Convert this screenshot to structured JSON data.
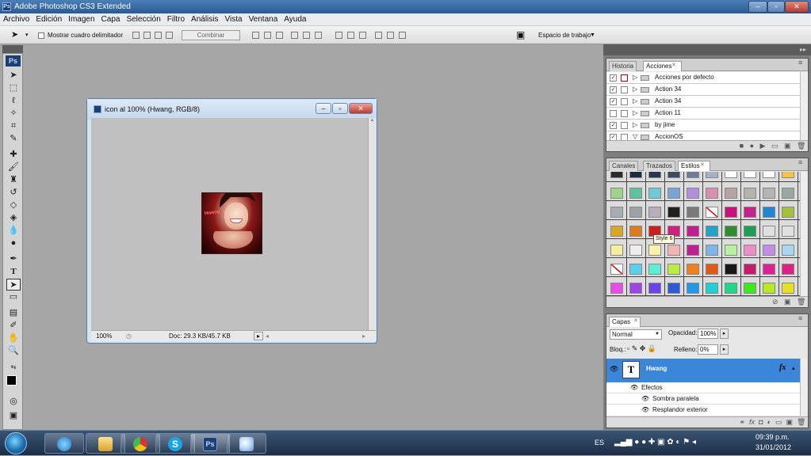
{
  "app": {
    "title": "Adobe Photoshop CS3 Extended",
    "ps_badge": "Ps"
  },
  "menu": [
    "Archivo",
    "Edición",
    "Imagen",
    "Capa",
    "Selección",
    "Filtro",
    "Análisis",
    "Vista",
    "Ventana",
    "Ayuda"
  ],
  "options": {
    "show_bounds": "Mostrar cuadro delimitador",
    "combine": "Combinar",
    "workspace": "Espacio de trabajo"
  },
  "document": {
    "title": "icon al 100% (Hwang, RGB/8)",
    "zoom": "100%",
    "doc_size": "Doc: 29.3 KB/45.7 KB",
    "photo_text": "Hwang"
  },
  "actions_panel": {
    "tabs": [
      "Historia",
      "Acciones"
    ],
    "active": "Acciones",
    "rows": [
      {
        "label": "Acciones por defecto",
        "checked": true
      },
      {
        "label": "Action 34",
        "checked": true
      },
      {
        "label": "Action 34",
        "checked": true
      },
      {
        "label": "Action 11",
        "checked": false
      },
      {
        "label": "by jime",
        "checked": true
      },
      {
        "label": "AccionOS",
        "checked": true
      }
    ]
  },
  "styles_panel": {
    "tabs": [
      "Canales",
      "Trazados",
      "Estilos"
    ],
    "active": "Estilos",
    "tooltip": "Style 6",
    "swatches": [
      [
        "#2b2b2b",
        "#1e2a44",
        "#2a3552",
        "#414a63",
        "#6e7c95",
        "#a6b1c6",
        "#ffffff",
        "#ffffff",
        "#ffffff",
        "#f5c242"
      ],
      [
        "#9fd28a",
        "#5dc2a0",
        "#6dc9d3",
        "#7ba3d6",
        "#b48fd9",
        "#d98fb0",
        "#b8a3a3",
        "#b9b2a8",
        "#b4b4b4",
        "#9aa8a4"
      ],
      [
        "#a8adb5",
        "#9da1a8",
        "#b7b0bc",
        "#202020",
        "#7a7a7a",
        "#ffffff",
        "#cc1079",
        "#cc1f8f",
        "#1e88d8",
        "#a3c23a"
      ],
      [
        "#d9a720",
        "#e07b1c",
        "#d21d1d",
        "#d71c82",
        "#c21e94",
        "#1fa5c7",
        "#2c8e2c",
        "#1d9e52",
        "#e0e0e0",
        "#e0e0e0"
      ],
      [
        "#f5ef9c",
        "#eeeeee",
        "#f7f2a8",
        "#f4b4b4",
        "#c21e94",
        "#7ab6e8",
        "#b4f29c",
        "#ec8cc8",
        "#c28de6",
        "#a8d8f0"
      ],
      [
        "#ffffff",
        "#5ad0ef",
        "#5af0d8",
        "#b8ee40",
        "#f08018",
        "#e05a14",
        "#181818",
        "#c81a6a",
        "#e01e96",
        "#e01f88"
      ],
      [
        "#e84de8",
        "#a044e8",
        "#6a44e8",
        "#2e5ad8",
        "#1e9ae8",
        "#1ed0d8",
        "#1ed88a",
        "#3ce81e",
        "#b8e81e",
        "#e8e01e"
      ]
    ]
  },
  "layers_panel": {
    "tab": "Capas",
    "blend": "Normal",
    "opacity_label": "Opacidad:",
    "opacity": "100%",
    "lock_label": "Bloq.:",
    "fill_label": "Relleno:",
    "fill": "0%",
    "layer_name": "Hwang",
    "layer_thumb": "T",
    "fx": "fx",
    "effects": "Efectos",
    "effect1": "Sombra paralela",
    "effect2": "Resplandor exterior"
  },
  "taskbar": {
    "lang": "ES",
    "time": "09:39 p.m.",
    "date": "31/01/2012"
  },
  "colors": {
    "layer_selected": "#3a86d8",
    "title_blue": "#2a5a94"
  }
}
